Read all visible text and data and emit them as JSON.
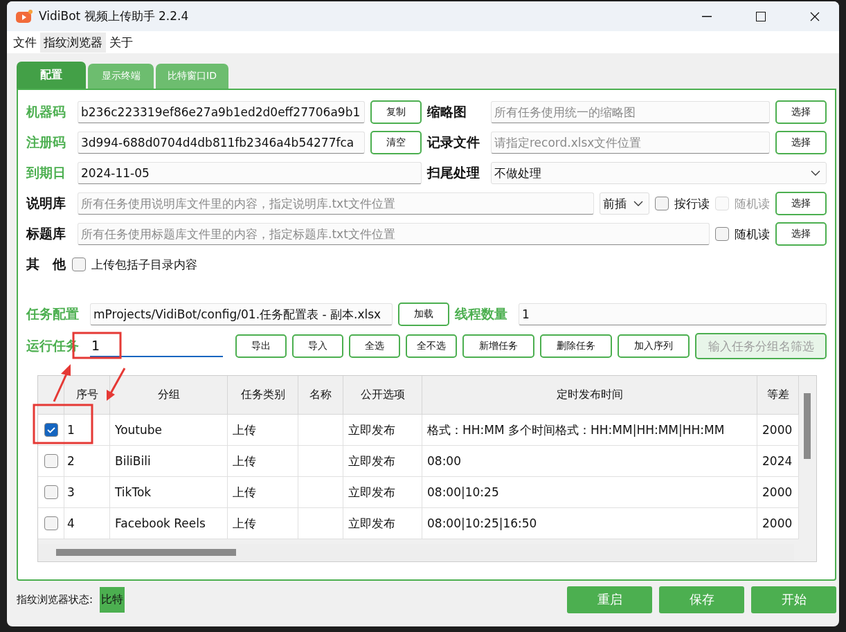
{
  "window": {
    "title": "VidiBot 视频上传助手 2.2.4"
  },
  "menu": [
    {
      "label": "文件",
      "selected": false
    },
    {
      "label": "指纹浏览器",
      "selected": true
    },
    {
      "label": "关于",
      "selected": false
    }
  ],
  "tabs": [
    {
      "label": "配置",
      "selected": true
    },
    {
      "label": "显示终端",
      "selected": false
    },
    {
      "label": "比特窗口ID",
      "selected": false
    }
  ],
  "machine_code": {
    "label": "机器码",
    "accent": true,
    "value": "b236c223319ef86e27a9b1ed2d0eff27706a9b1",
    "button": "复制"
  },
  "thumbnail": {
    "label": "缩略图",
    "accent": false,
    "placeholder": "所有任务使用统一的缩略图",
    "button": "选择"
  },
  "registration_code": {
    "label": "注册码",
    "accent": true,
    "value": "3d994-688d0704d4db811fb2346a4b54277fca",
    "button": "清空"
  },
  "record_file": {
    "label": "记录文件",
    "accent": false,
    "placeholder": "请指定record.xlsx文件位置",
    "button": "选择"
  },
  "expiry": {
    "label": "到期日",
    "accent": true,
    "value": "2024-11-05"
  },
  "tail_processing": {
    "label": "扫尾处理",
    "accent": false,
    "value": "不做处理"
  },
  "description_library": {
    "label": "说明库",
    "accent": false,
    "placeholder": "所有任务使用说明库文件里的内容，指定说明库.txt文件位置",
    "mode": "前插",
    "line_read": {
      "label": "按行读",
      "checked": false,
      "disabled": false
    },
    "random_read": {
      "label": "随机读",
      "checked": false,
      "disabled": true
    },
    "button": "选择"
  },
  "title_library": {
    "label": "标题库",
    "accent": false,
    "placeholder": "所有任务使用标题库文件里的内容，指定标题库.txt文件位置",
    "random_read": {
      "label": "随机读",
      "checked": false,
      "disabled": false
    },
    "button": "选择"
  },
  "other": {
    "label": "其　他",
    "option": {
      "label": "上传包括子目录内容",
      "checked": false,
      "disabled": false
    }
  },
  "task_config": {
    "label": "任务配置",
    "value": "mProjects/VidiBot/config/01.任务配置表 - 副本.xlsx",
    "button": "加载"
  },
  "threads": {
    "label": "线程数量",
    "value": "1"
  },
  "run_task": {
    "label": "运行任务",
    "value": "1"
  },
  "actions": [
    "导出",
    "导入",
    "全选",
    "全不选",
    "新增任务",
    "删除任务",
    "加入序列"
  ],
  "filter": {
    "placeholder": "输入任务分组名筛选"
  },
  "table": {
    "columns": [
      "序号",
      "分组",
      "任务类别",
      "名称",
      "公开选项",
      "定时发布时间",
      "等差"
    ],
    "rows": [
      {
        "checked": true,
        "index": "1",
        "group": "Youtube",
        "type": "上传",
        "visibility": "立即发布",
        "schedule": "格式：HH:MM 多个时间格式：HH:MM|HH:MM|HH:MM",
        "column_7": "2000"
      },
      {
        "checked": false,
        "index": "2",
        "group": "BiliBili",
        "type": "上传",
        "visibility": "立即发布",
        "schedule": "08:00",
        "column_7": "2024"
      },
      {
        "checked": false,
        "index": "3",
        "group": "TikTok",
        "type": "上传",
        "visibility": "立即发布",
        "schedule": "08:00|10:25",
        "column_7": "2000"
      },
      {
        "checked": false,
        "index": "4",
        "group": "Facebook Reels",
        "type": "上传",
        "visibility": "立即发布",
        "schedule": "08:00|10:25|16:50",
        "column_7": "2000"
      }
    ]
  },
  "status": {
    "label": "指纹浏览器状态:",
    "value": "比特"
  },
  "footer_buttons": [
    "重启",
    "保存",
    "开始"
  ]
}
